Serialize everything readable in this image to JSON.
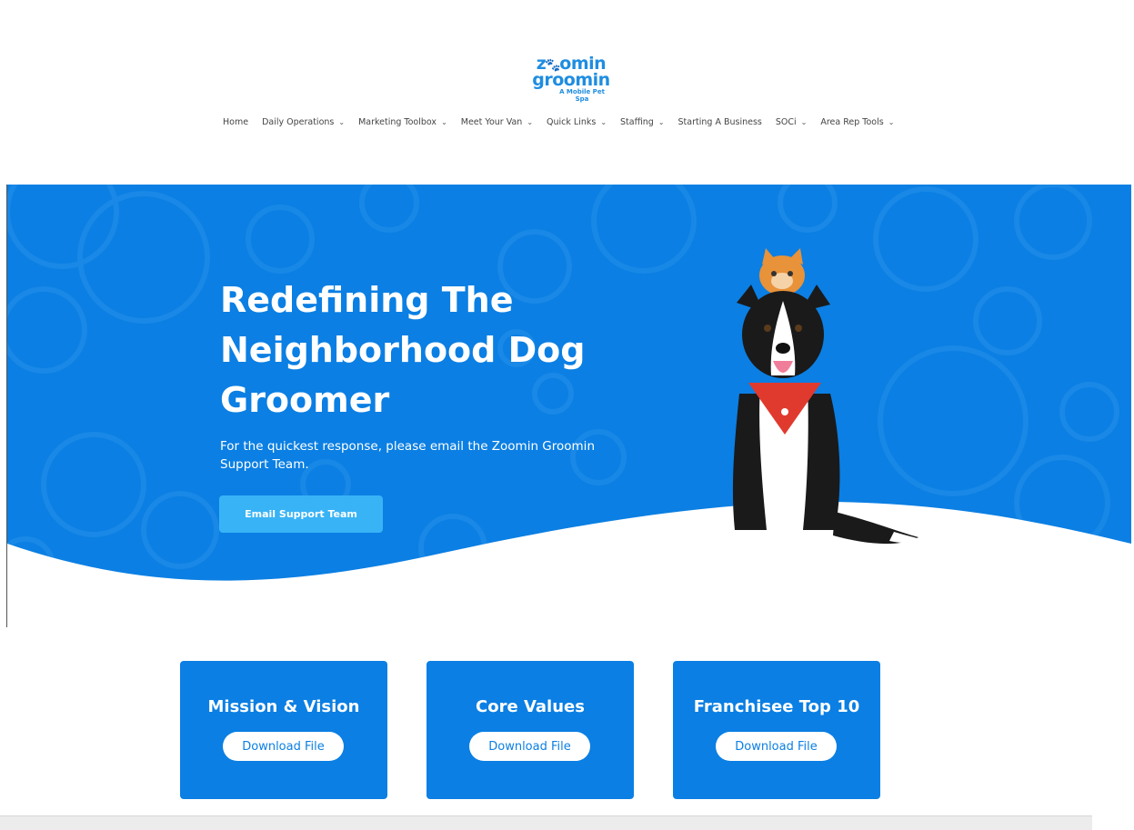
{
  "logo": {
    "line1_a": "z",
    "line1_b": "omin",
    "line2": "groomin",
    "tagline": "A Mobile Pet Spa"
  },
  "nav": {
    "items": [
      {
        "label": "Home",
        "has_dropdown": false
      },
      {
        "label": "Daily Operations",
        "has_dropdown": true
      },
      {
        "label": "Marketing Toolbox",
        "has_dropdown": true
      },
      {
        "label": "Meet Your Van",
        "has_dropdown": true
      },
      {
        "label": "Quick Links",
        "has_dropdown": true
      },
      {
        "label": "Staffing",
        "has_dropdown": true
      },
      {
        "label": "Starting A Business",
        "has_dropdown": false
      },
      {
        "label": "SOCi",
        "has_dropdown": true
      },
      {
        "label": "Area Rep Tools",
        "has_dropdown": true
      }
    ],
    "chevron": "⌄"
  },
  "hero": {
    "title_line1": "Redefining The",
    "title_line2": "Neighborhood Dog",
    "title_line3": "Groomer",
    "subtitle": "For the quickest response, please email the Zoomin Groomin Support Team.",
    "button_label": "Email Support Team",
    "image": "dog-and-cat-photo"
  },
  "cards": [
    {
      "title": "Mission & Vision",
      "button_label": "Download File"
    },
    {
      "title": "Core Values",
      "button_label": "Download File"
    },
    {
      "title": "Franchisee Top 10",
      "button_label": "Download File"
    }
  ],
  "colors": {
    "brand_blue": "#0b7fe3",
    "button_light_blue": "#38b3f6",
    "logo_paw_orange": "#f2a13a"
  }
}
